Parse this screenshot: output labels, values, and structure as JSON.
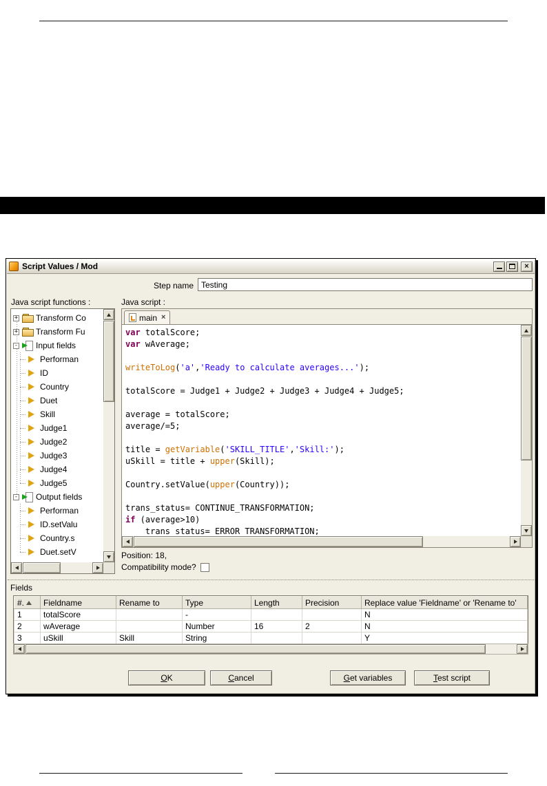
{
  "dialog": {
    "title": "Script Values / Mod",
    "step_name_label": "Step name",
    "step_name_value": "Testing",
    "functions_label": "Java script functions :",
    "script_label": "Java script :",
    "tree": {
      "items": [
        {
          "level": 0,
          "expander": "+",
          "icon": "folder",
          "label": "Transform Co"
        },
        {
          "level": 0,
          "expander": "+",
          "icon": "folder",
          "label": "Transform Fu"
        },
        {
          "level": 0,
          "expander": "-",
          "icon": "input",
          "label": "Input fields"
        },
        {
          "level": 1,
          "icon": "leaf",
          "label": "Performan"
        },
        {
          "level": 1,
          "icon": "leaf",
          "label": "ID"
        },
        {
          "level": 1,
          "icon": "leaf",
          "label": "Country"
        },
        {
          "level": 1,
          "icon": "leaf",
          "label": "Duet"
        },
        {
          "level": 1,
          "icon": "leaf",
          "label": "Skill"
        },
        {
          "level": 1,
          "icon": "leaf",
          "label": "Judge1"
        },
        {
          "level": 1,
          "icon": "leaf",
          "label": "Judge2"
        },
        {
          "level": 1,
          "icon": "leaf",
          "label": "Judge3"
        },
        {
          "level": 1,
          "icon": "leaf",
          "label": "Judge4"
        },
        {
          "level": 1,
          "icon": "leaf",
          "label": "Judge5"
        },
        {
          "level": 0,
          "expander": "-",
          "icon": "output",
          "label": "Output fields"
        },
        {
          "level": 1,
          "icon": "leaf",
          "label": "Performan"
        },
        {
          "level": 1,
          "icon": "leaf",
          "label": "ID.setValu"
        },
        {
          "level": 1,
          "icon": "leaf",
          "label": "Country.s"
        },
        {
          "level": 1,
          "icon": "leaf",
          "label": "Duet.setV"
        }
      ]
    },
    "script": {
      "tab_label": "main",
      "position_text": "Position: 18,",
      "compat_label": "Compatibility mode?",
      "lines": [
        [
          [
            "k",
            "var"
          ],
          [
            "p",
            " totalScore;"
          ]
        ],
        [
          [
            "k",
            "var"
          ],
          [
            "p",
            " wAverage;"
          ]
        ],
        [],
        [
          [
            "f",
            "writeToLog"
          ],
          [
            "p",
            "("
          ],
          [
            "s",
            "'a'"
          ],
          [
            "p",
            ","
          ],
          [
            "s",
            "'Ready to calculate averages...'"
          ],
          [
            "p",
            ");"
          ]
        ],
        [],
        [
          [
            "p",
            "totalScore = Judge1 + Judge2 + Judge3 + Judge4 + Judge5;"
          ]
        ],
        [],
        [
          [
            "p",
            "average = totalScore;"
          ]
        ],
        [
          [
            "p",
            "average/=5;"
          ]
        ],
        [],
        [
          [
            "p",
            "title = "
          ],
          [
            "f",
            "getVariable"
          ],
          [
            "p",
            "("
          ],
          [
            "s",
            "'SKILL_TITLE'"
          ],
          [
            "p",
            ","
          ],
          [
            "s",
            "'Skill:'"
          ],
          [
            "p",
            ");"
          ]
        ],
        [
          [
            "p",
            "uSkill = title + "
          ],
          [
            "f",
            "upper"
          ],
          [
            "p",
            "(Skill);"
          ]
        ],
        [],
        [
          [
            "p",
            "Country.setValue("
          ],
          [
            "f",
            "upper"
          ],
          [
            "p",
            "(Country));"
          ]
        ],
        [],
        [
          [
            "p",
            "trans_status= CONTINUE_TRANSFORMATION;"
          ]
        ],
        [
          [
            "k",
            "if"
          ],
          [
            "p",
            " (average>10)"
          ]
        ],
        [
          [
            "p",
            "    trans_status= ERROR_TRANSFORMATION;"
          ]
        ]
      ]
    },
    "fields": {
      "label": "Fields",
      "columns": [
        "#.",
        "Fieldname",
        "Rename to",
        "Type",
        "Length",
        "Precision",
        "Replace value 'Fieldname' or 'Rename to'"
      ],
      "rows": [
        [
          "1",
          "totalScore",
          "",
          "-",
          "",
          "",
          "N"
        ],
        [
          "2",
          "wAverage",
          "",
          "Number",
          "16",
          "2",
          "N"
        ],
        [
          "3",
          "uSkill",
          "Skill",
          "String",
          "",
          "",
          "Y"
        ]
      ]
    },
    "buttons": [
      {
        "label": "OK",
        "mnemonic": 0
      },
      {
        "label": "Cancel",
        "mnemonic": 0
      },
      {
        "label": "Get variables",
        "mnemonic": 0
      },
      {
        "label": "Test script",
        "mnemonic": 0
      }
    ],
    "colors": {
      "keyword": "#7f0055",
      "function": "#d06f00",
      "string": "#2a00ff",
      "plain": "#000000",
      "dialog_bg": "#f1eee3"
    }
  }
}
